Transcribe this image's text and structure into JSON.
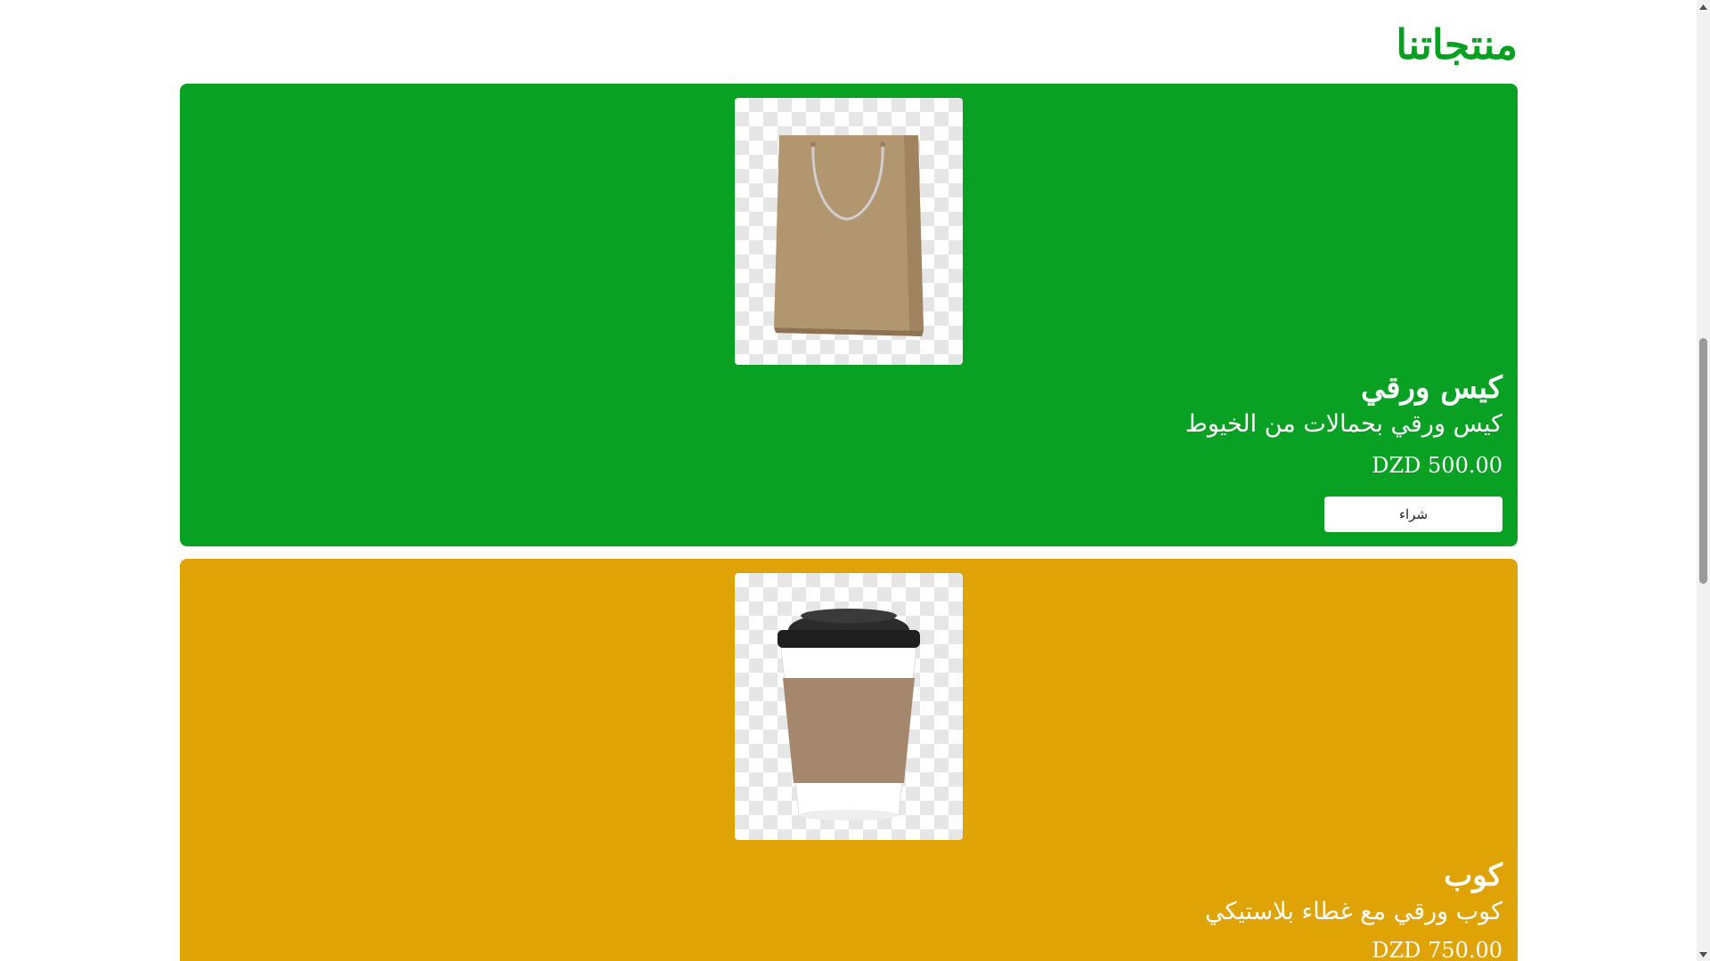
{
  "page": {
    "title": "منتجاتنا",
    "colors": {
      "title": "#07a020",
      "card_green": "#08a123",
      "card_orange": "#e0a306",
      "text_on_card": "#ffffff"
    }
  },
  "products": [
    {
      "title": "كيس ورقي",
      "description": "كيس ورقي بحمالات من الخيوط",
      "price": "DZD 500.00",
      "image_icon": "paper-bag-icon",
      "buy_label": "شراء"
    },
    {
      "title": "كوب",
      "description": "كوب ورقي مع غطاء بلاستيكي",
      "price": "DZD 750.00",
      "image_icon": "coffee-cup-icon"
    }
  ],
  "scrollbar": {
    "up_icon": "scroll-up-arrow-icon",
    "down_icon": "scroll-down-arrow-icon"
  }
}
